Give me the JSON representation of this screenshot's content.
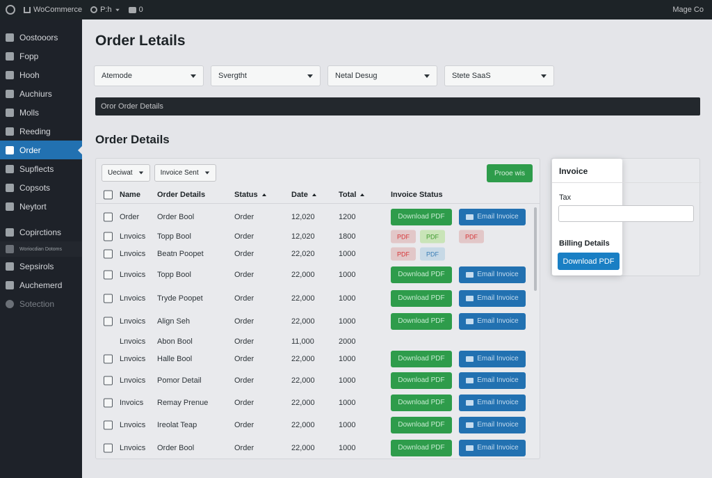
{
  "admin_bar": {
    "site_name": "WoCommerce",
    "updates": "P:h",
    "comments_count": "0",
    "account": "Mage Co"
  },
  "sidebar": {
    "items": [
      {
        "label": "Oostooors",
        "icon": "dashboard-icon"
      },
      {
        "label": "Fopp",
        "icon": "pin-icon"
      },
      {
        "label": "Hooh",
        "icon": "media-icon"
      },
      {
        "label": "Auchiurs",
        "icon": "pages-icon"
      },
      {
        "label": "Molls",
        "icon": "comments-icon"
      },
      {
        "label": "Reeding",
        "icon": "appearance-icon"
      },
      {
        "label": "Order",
        "icon": "order-icon",
        "active": true
      },
      {
        "label": "Supflects",
        "icon": "plugins-icon"
      },
      {
        "label": "Copsots",
        "icon": "users-icon"
      },
      {
        "label": "Neytort",
        "icon": "tools-icon"
      },
      {
        "label": "Copirctions",
        "icon": "settings-icon"
      },
      {
        "label": "Woriocdian Dotoms",
        "icon": "sub-icon"
      },
      {
        "label": "Sepsirols",
        "icon": "extensions-icon"
      },
      {
        "label": "Auchemerd",
        "icon": "reports-icon"
      },
      {
        "label": "Sotection",
        "icon": "collapse-icon"
      }
    ]
  },
  "page": {
    "title": "Order Letails",
    "filters": [
      "Atemode",
      "Svergtht",
      "Netal Desug",
      "Stete SaaS"
    ],
    "dark_bar": "Oror Order Details",
    "section_title": "Order Details"
  },
  "table": {
    "bulk_select": "Ueciwat",
    "invoice_select": "Invoice Sent",
    "process_button": "Prooe wis",
    "columns": [
      "Name",
      "Order Details",
      "Status",
      "Date",
      "Total",
      "Invoice Status"
    ],
    "download_label": "Download PDF",
    "email_label": "Email Invoice",
    "pdf_label": "PDF",
    "rows": [
      {
        "name": "Order",
        "details": "Order Bool",
        "status": "Order",
        "date": "12,020",
        "total": "1200"
      },
      {
        "name": "Lnvoics",
        "details": "Topp Bool",
        "status": "Order",
        "date": "12,020",
        "total": "1800"
      },
      {
        "name": "Lnvoics",
        "details": "Beatn Poopet",
        "status": "Order",
        "date": "22,020",
        "total": "1000"
      },
      {
        "name": "Lnvoics",
        "details": "Topp Bool",
        "status": "Order",
        "date": "22,000",
        "total": "1000"
      },
      {
        "name": "Lnvoics",
        "details": "Tryde Poopet",
        "status": "Order",
        "date": "22,000",
        "total": "1000"
      },
      {
        "name": "Lnvoics",
        "details": "Align Seh",
        "status": "Order",
        "date": "22,000",
        "total": "1000"
      },
      {
        "name": "Lnvoics",
        "details": "Abon Bool",
        "status": "Order",
        "date": "11,000",
        "total": "2000"
      },
      {
        "name": "Lnvoics",
        "details": "Halle Bool",
        "status": "Order",
        "date": "22,000",
        "total": "1000"
      },
      {
        "name": "Lnvoics",
        "details": "Pomor Detail",
        "status": "Order",
        "date": "22,000",
        "total": "1000"
      },
      {
        "name": "Invoics",
        "details": "Remay Prenue",
        "status": "Order",
        "date": "22,000",
        "total": "1000"
      },
      {
        "name": "Lnvoics",
        "details": "Ireolat Teap",
        "status": "Order",
        "date": "22,000",
        "total": "1000"
      },
      {
        "name": "Lnvoics",
        "details": "Order Bool",
        "status": "Order",
        "date": "22,000",
        "total": "1000"
      }
    ]
  },
  "invoice_card": {
    "title": "Invoice",
    "tax_label": "Tax",
    "billing_label": "Billing Details",
    "download_button": "Download PDF"
  },
  "colors": {
    "sidebar_bg": "#1e2229",
    "accent": "#2271b1",
    "green": "#2e9c4b",
    "pdf_red": "#d63638"
  }
}
